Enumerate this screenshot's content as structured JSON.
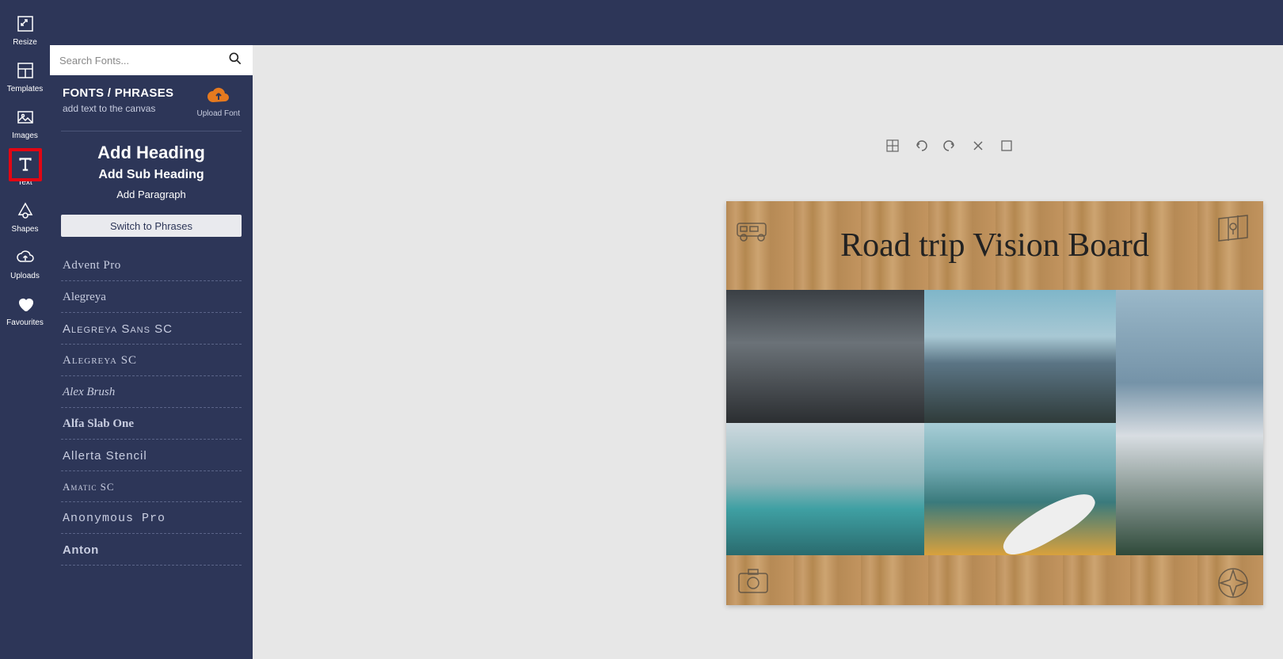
{
  "rail": {
    "items": [
      {
        "label": "Resize",
        "icon": "resize"
      },
      {
        "label": "Templates",
        "icon": "templates"
      },
      {
        "label": "Images",
        "icon": "images"
      },
      {
        "label": "Text",
        "icon": "text",
        "active": true
      },
      {
        "label": "Shapes",
        "icon": "shapes"
      },
      {
        "label": "Uploads",
        "icon": "uploads"
      },
      {
        "label": "Favourites",
        "icon": "favourites"
      }
    ]
  },
  "search": {
    "placeholder": "Search Fonts..."
  },
  "panel": {
    "title": "FONTS / PHRASES",
    "subtitle": "add text to the canvas",
    "upload_label": "Upload Font",
    "add_heading": "Add Heading",
    "add_subheading": "Add Sub Heading",
    "add_paragraph": "Add Paragraph",
    "switch_label": "Switch to Phrases"
  },
  "fonts": [
    "Advent Pro",
    "Alegreya",
    "Alegreya Sans SC",
    "Alegreya SC",
    "Alex Brush",
    "Alfa Slab One",
    "Allerta Stencil",
    "Amatic SC",
    "Anonymous Pro",
    "Anton"
  ],
  "canvas": {
    "title": "Road trip Vision Board",
    "corner_icons": {
      "top_left": "camper-van-icon",
      "top_right": "map-pin-icon",
      "bottom_left": "camera-icon",
      "bottom_right": "compass-icon"
    }
  },
  "toolbar_icons": [
    "grid",
    "undo",
    "redo",
    "close",
    "square"
  ]
}
